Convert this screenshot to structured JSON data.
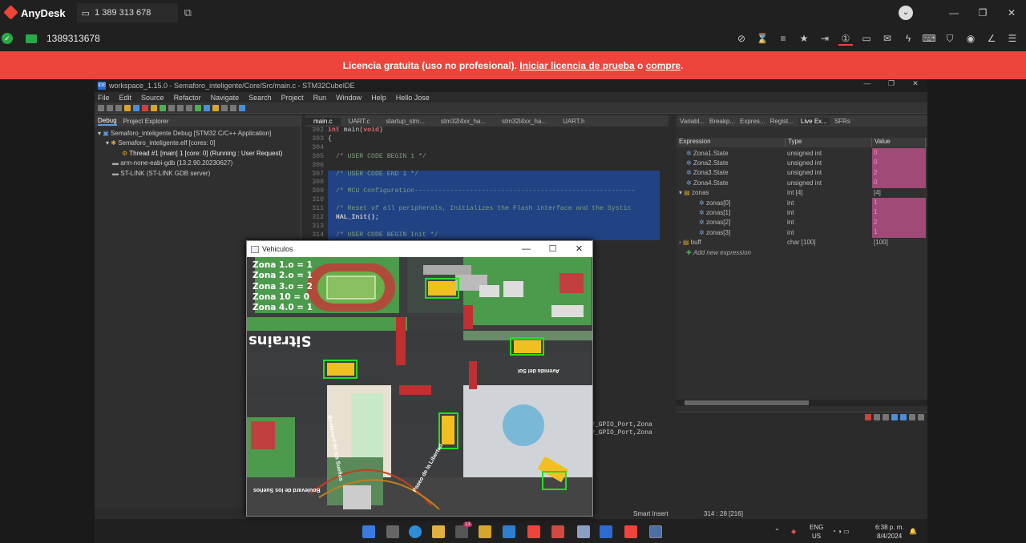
{
  "anydesk": {
    "app_name": "AnyDesk",
    "tab_label": "1 389 313 678",
    "address": "1389313678",
    "banner_text": "Licencia gratuita (uso no profesional).",
    "banner_link1": "Iniciar licencia de prueba",
    "banner_mid": "o",
    "banner_link2": "compre",
    "banner_end": "."
  },
  "ide": {
    "title": "workspace_1.15.0 - Semaforo_inteligente/Core/Src/main.c - STM32CubeIDE",
    "menu": [
      "File",
      "Edit",
      "Source",
      "Refactor",
      "Navigate",
      "Search",
      "Project",
      "Run",
      "Window",
      "Help",
      "Hello Jose"
    ],
    "left_tabs": [
      "Debug",
      "Project Explorer"
    ],
    "debug_tree": [
      "Semaforo_inteligente Debug [STM32 C/C++ Application]",
      "Semaforo_inteligente.elf [cores: 0]",
      "Thread #1 [main] 1 [core: 0] (Running : User Request)",
      "arm-none-eabi-gdb (13.2.90.20230627)",
      "ST-LINK (ST-LINK GDB server)"
    ],
    "editor_tabs": [
      "main.c",
      "UART.c",
      "startup_stm...",
      "stm32l4xx_ha...",
      "stm32l4xx_ha...",
      "UART.h"
    ],
    "line_numbers": [
      "302",
      "303",
      "304",
      "305",
      "306",
      "307",
      "308",
      "309",
      "310",
      "311",
      "312",
      "313",
      "314"
    ],
    "code": {
      "l302a": "int",
      "l302b": " main(",
      "l302c": "void",
      "l302d": ")",
      "l303": "{",
      "l305": "  /* USER CODE BEGIN 1 */",
      "l307": "  /* USER CODE END 1 */",
      "l309": "  /* MCU Configuration--------------------------------------------------------",
      "l311": "  /* Reset of all peripherals, Initializes the Flash interface and the Systic",
      "l312": "  HAL_Init();",
      "l314": "  /* USER CODE BEGIN Init */",
      "tail1": "V_GPIO_Port,Zona",
      "tail2": "V_GPIO_Port,Zona"
    },
    "right_tabs": [
      "Variabl...",
      "Breakp...",
      "Expres...",
      "Regist...",
      "Live Ex...",
      "SFRs"
    ],
    "expr_headers": [
      "Expression",
      "Type",
      "Value"
    ],
    "expressions": [
      {
        "name": "Zona1.State",
        "type": "unsigned int",
        "value": "0",
        "changed": true
      },
      {
        "name": "Zona2.State",
        "type": "unsigned int",
        "value": "0",
        "changed": true
      },
      {
        "name": "Zona3.State",
        "type": "unsigned int",
        "value": "2",
        "changed": true
      },
      {
        "name": "Zona4.State",
        "type": "unsigned int",
        "value": "0",
        "changed": true
      },
      {
        "name": "zonas",
        "type": "int [4]",
        "value": "[4]",
        "changed": false
      },
      {
        "name": "zonas[0]",
        "type": "int",
        "value": "1",
        "changed": true
      },
      {
        "name": "zonas[1]",
        "type": "int",
        "value": "1",
        "changed": true
      },
      {
        "name": "zonas[2]",
        "type": "int",
        "value": "2",
        "changed": true
      },
      {
        "name": "zonas[3]",
        "type": "int",
        "value": "1",
        "changed": true
      },
      {
        "name": "buff",
        "type": "char [100]",
        "value": "[100]",
        "changed": false
      }
    ],
    "add_expression": "Add new expression",
    "status_insert": "Smart Insert",
    "status_pos": "314 : 28 [216]"
  },
  "vehiculos": {
    "title": "Vehiculos",
    "overlay": [
      "Zona 1.o = 1",
      "Zona 2.o = 1",
      "Zona 3.o = 2",
      "Zona 10 = 0",
      "Zona 4.0 = 1"
    ],
    "map_text_1": "Sitrains",
    "map_text_2": "Avenida del Sol",
    "map_text_3": "Boulevard de los Sueños",
    "map_text_4": "Paseo de la Libertad",
    "map_text_5": "Boulevard de los Sueños"
  },
  "taskbar": {
    "lang1": "ENG",
    "lang2": "US",
    "time": "6:38 p. m.",
    "date": "8/4/2024",
    "badge": "13"
  }
}
